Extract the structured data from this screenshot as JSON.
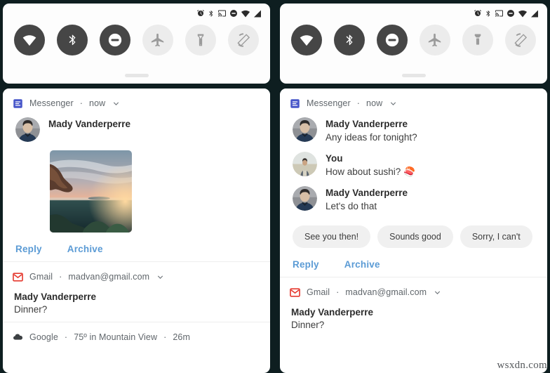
{
  "theme": {
    "background": "#0e1e20",
    "card_background": "#ffffff",
    "tile_on": "#464646",
    "tile_off": "#ececec",
    "link_blue": "#5b9bd5",
    "chip_background": "#f0f0f0",
    "messenger_blue": "#4756c9",
    "gmail_red": "#e5392f"
  },
  "statusbar": {
    "icons": [
      "alarm-icon",
      "bluetooth-icon",
      "cast-icon",
      "do-not-disturb-icon",
      "wifi-icon",
      "signal-icon"
    ]
  },
  "quick_settings": {
    "tiles": [
      {
        "name": "wifi",
        "icon": "wifi-icon",
        "state": "on"
      },
      {
        "name": "bluetooth",
        "icon": "bluetooth-icon",
        "state": "on"
      },
      {
        "name": "do-not-disturb",
        "icon": "do-not-disturb-icon",
        "state": "on"
      },
      {
        "name": "airplane-mode",
        "icon": "airplane-icon",
        "state": "off"
      },
      {
        "name": "flashlight",
        "icon": "flashlight-icon",
        "state": "off"
      },
      {
        "name": "auto-rotate",
        "icon": "auto-rotate-icon",
        "state": "off"
      }
    ]
  },
  "left_panel": {
    "messenger": {
      "app_name": "Messenger",
      "separator": "·",
      "time": "now",
      "sender": "Mady Vanderperre",
      "has_image_attachment": true,
      "actions": [
        "Reply",
        "Archive"
      ]
    },
    "gmail": {
      "app_name": "Gmail",
      "separator": "·",
      "account": "madvan@gmail.com",
      "subject": "Mady Vanderperre",
      "preview": "Dinner?"
    },
    "google": {
      "app_name": "Google",
      "separator": "·",
      "weather": "75º in Mountain View",
      "time": "26m"
    }
  },
  "right_panel": {
    "messenger": {
      "app_name": "Messenger",
      "separator": "·",
      "time": "now",
      "messages": [
        {
          "sender": "Mady Vanderperre",
          "text": "Any ideas for tonight?",
          "avatar": "contact-photo"
        },
        {
          "sender": "You",
          "text": "How about sushi? 🍣",
          "avatar": "self-photo"
        },
        {
          "sender": "Mady Vanderperre",
          "text": "Let's do that",
          "avatar": "contact-photo"
        }
      ],
      "smart_replies": [
        "See you then!",
        "Sounds good",
        "Sorry, I can't"
      ],
      "actions": [
        "Reply",
        "Archive"
      ]
    },
    "gmail": {
      "app_name": "Gmail",
      "separator": "·",
      "account": "madvan@gmail.com",
      "subject": "Mady Vanderperre",
      "preview": "Dinner?"
    }
  },
  "watermark": "wsxdn.com"
}
